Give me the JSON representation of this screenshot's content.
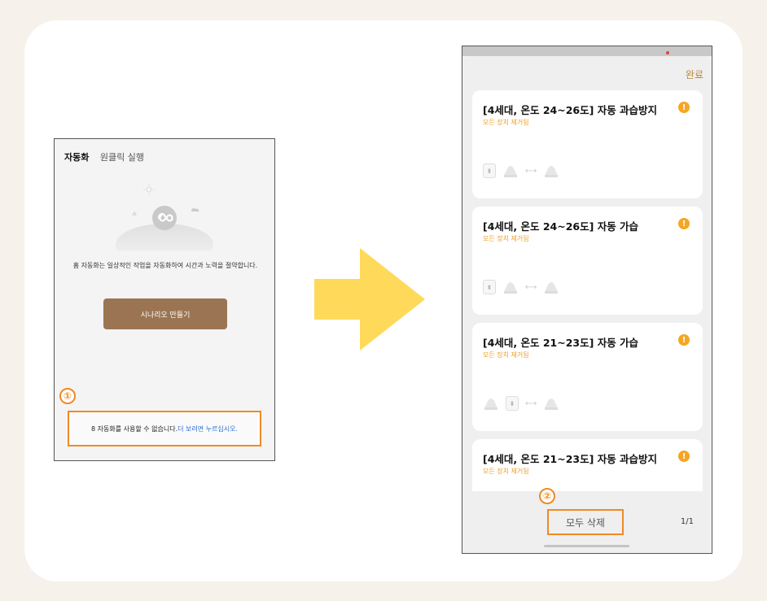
{
  "left_phone": {
    "tabs": {
      "active": "자동화",
      "inactive": "원클릭 실행"
    },
    "description": "홈 자동화는 일상적인 작업을 자동화하여 시간과 노력을 절약합니다.",
    "create_button": "시나리오 만들기",
    "notice_text": "8 자동화를 사용할 수 없습니다.",
    "notice_link": "더 보려면 누르십시오.",
    "badge": "①"
  },
  "right_phone": {
    "done_label": "완료",
    "items": [
      {
        "title": "[4세대, 온도 24~26도] 자동 과습방지",
        "subtitle": "모든 장치 제거됨",
        "warn": "!"
      },
      {
        "title": "[4세대, 온도 24~26도] 자동 가습",
        "subtitle": "모든 장치 제거됨",
        "warn": "!"
      },
      {
        "title": "[4세대, 온도 21~23도] 자동 가습",
        "subtitle": "모든 장치 제거됨",
        "warn": "!"
      },
      {
        "title": "[4세대, 온도 21~23도] 자동 과습방지",
        "subtitle": "모든 장치 제거됨",
        "warn": "!"
      }
    ],
    "delete_all": "모두 삭제",
    "page_indicator": "1/1",
    "badge": "②"
  },
  "colors": {
    "highlight": "#f08a24",
    "arrow": "#ffd95a",
    "primary_button": "#9b7553",
    "warning": "#f5a623",
    "link": "#2d6fd6"
  },
  "icons": [
    "sun-icon",
    "cloud-icon",
    "automation-loop-icon",
    "thermometer-icon",
    "humidifier-icon",
    "double-arrow-icon",
    "warning-icon"
  ]
}
